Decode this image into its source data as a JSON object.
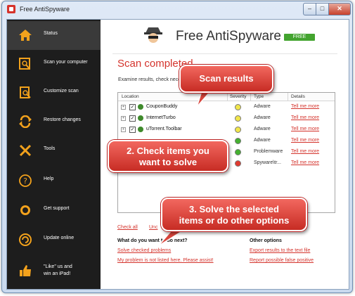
{
  "window": {
    "title": "Free AntiSpyware",
    "min_label": "–",
    "max_label": "□",
    "close_label": "✕"
  },
  "sidebar": {
    "items": [
      {
        "label": "Status",
        "icon": "home-icon"
      },
      {
        "label": "Scan your computer",
        "icon": "scan-computer-icon"
      },
      {
        "label": "Customize scan",
        "icon": "customize-scan-icon"
      },
      {
        "label": "Restore changes",
        "icon": "restore-icon"
      },
      {
        "label": "Tools",
        "icon": "tools-icon"
      },
      {
        "label": "Help",
        "icon": "help-icon"
      },
      {
        "label": "Get support",
        "icon": "support-icon"
      },
      {
        "label": "Update online",
        "icon": "update-icon"
      },
      {
        "label_line1": "\"Like\" us and",
        "label_line2": "win an iPad!",
        "icon": "thumbs-up-icon"
      }
    ]
  },
  "header": {
    "brand_name": "Free AntiSpyware",
    "badge": "FREE"
  },
  "main": {
    "title": "Scan completed",
    "subtitle": "Examine results, check necess",
    "columns": {
      "location": "Location",
      "severity": "Severity",
      "type": "Type",
      "details": "Details"
    },
    "rows": [
      {
        "name": "CouponBuddy",
        "severity": "yellow",
        "type": "Adware",
        "details": "Tell me more",
        "checked": "✓"
      },
      {
        "name": "InternetTurbo",
        "severity": "yellow",
        "type": "Adware",
        "details": "Tell me more",
        "checked": "✓"
      },
      {
        "name": "uTorrent.Toolbar",
        "severity": "yellow",
        "type": "Adware",
        "details": "Tell me more",
        "checked": "✓"
      },
      {
        "name": "",
        "severity": "green",
        "type": "Adware",
        "details": "Tell me more",
        "checked": ""
      },
      {
        "name": "",
        "severity": "green",
        "type": "Problemware",
        "details": "Tell me more",
        "checked": ""
      },
      {
        "name": "",
        "severity": "red",
        "type": "Spyware\\tr...",
        "details": "Tell me more",
        "checked": ""
      }
    ],
    "check_all": "Check all",
    "uncheck_partial": "Unc",
    "next_heading": "What do you want to do next?",
    "solve_link": "Solve checked problems",
    "not_listed_link": "My problem is not listed here. Please assist!",
    "other_heading": "Other options",
    "export_link": "Export results to the text file",
    "false_positive_link": "Report possible false positive"
  },
  "callouts": {
    "scan_results": "Scan results",
    "check_line1": "2. Check items you",
    "check_line2": "want to solve",
    "solve_line1": "3. Solve the selected",
    "solve_line2": "items or do other options"
  },
  "colors": {
    "accent_red": "#d4332c",
    "badge_green": "#43a42f",
    "sidebar_bg": "#1d1d1d",
    "sev_yellow": "#f1e64a",
    "sev_green": "#43b02f",
    "sev_red": "#e03a2f"
  }
}
